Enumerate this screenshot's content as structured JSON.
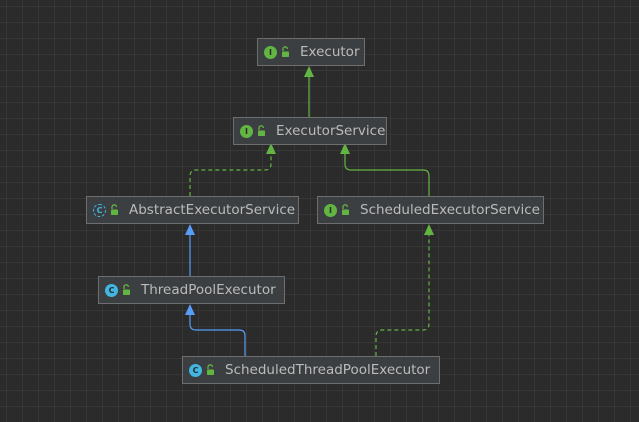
{
  "colors": {
    "background": "#2b2b2b",
    "node_fill": "#3c3f41",
    "node_border": "#6e6e6e",
    "text": "#bbbbbb",
    "interface_badge": "#62b543",
    "class_badge": "#40b6e0",
    "implements_edge": "#62b543",
    "extends_edge": "#589df6"
  },
  "nodes": [
    {
      "id": "executor",
      "label": "Executor",
      "kind": "interface",
      "badge": "I",
      "lock_icon": "unlock-icon"
    },
    {
      "id": "executor-service",
      "label": "ExecutorService",
      "kind": "interface",
      "badge": "I",
      "lock_icon": "unlock-icon"
    },
    {
      "id": "abstract-executor-service",
      "label": "AbstractExecutorService",
      "kind": "abstract-class",
      "badge": "C",
      "lock_icon": "unlock-icon"
    },
    {
      "id": "scheduled-executor-service",
      "label": "ScheduledExecutorService",
      "kind": "interface",
      "badge": "I",
      "lock_icon": "unlock-icon"
    },
    {
      "id": "thread-pool-executor",
      "label": "ThreadPoolExecutor",
      "kind": "class",
      "badge": "C",
      "lock_icon": "unlock-icon"
    },
    {
      "id": "scheduled-thread-pool-executor",
      "label": "ScheduledThreadPoolExecutor",
      "kind": "class",
      "badge": "C",
      "lock_icon": "unlock-icon"
    }
  ],
  "edges": [
    {
      "from": "executor-service",
      "to": "executor",
      "relation": "extends",
      "style": "solid",
      "color": "#62b543"
    },
    {
      "from": "abstract-executor-service",
      "to": "executor-service",
      "relation": "implements",
      "style": "dashed",
      "color": "#62b543"
    },
    {
      "from": "scheduled-executor-service",
      "to": "executor-service",
      "relation": "extends",
      "style": "solid",
      "color": "#62b543"
    },
    {
      "from": "thread-pool-executor",
      "to": "abstract-executor-service",
      "relation": "extends",
      "style": "solid",
      "color": "#589df6"
    },
    {
      "from": "scheduled-thread-pool-executor",
      "to": "thread-pool-executor",
      "relation": "extends",
      "style": "solid",
      "color": "#589df6"
    },
    {
      "from": "scheduled-thread-pool-executor",
      "to": "scheduled-executor-service",
      "relation": "implements",
      "style": "dashed",
      "color": "#62b543"
    }
  ]
}
